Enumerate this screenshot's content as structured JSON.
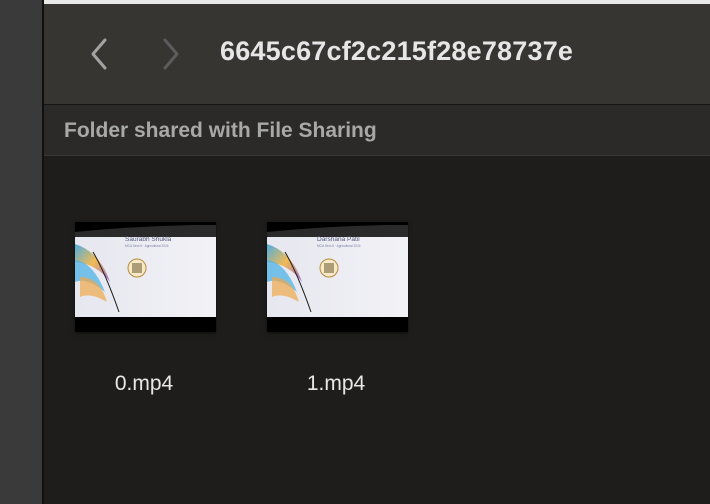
{
  "window": {
    "title": "6645c67cf2c215f28e78737e"
  },
  "toolbar": {
    "back_icon": "chevron-left-icon",
    "forward_icon": "chevron-right-icon"
  },
  "section": {
    "title": "Folder shared with File Sharing"
  },
  "files": [
    {
      "name": "0.mp4",
      "thumbnail": {
        "person_name": "Saurabh Shukla",
        "subtitle": "MCA Sem II · Agricultural 2024"
      }
    },
    {
      "name": "1.mp4",
      "thumbnail": {
        "person_name": "Darshana Patil",
        "subtitle": "MCA Sem II · Agricultural 2024"
      }
    }
  ],
  "colors": {
    "background": "#1e1d1b",
    "toolbar": "#363532",
    "section_header": "#2b2a28",
    "title_text": "#e6e6e6",
    "section_text": "#a8a8a8"
  }
}
